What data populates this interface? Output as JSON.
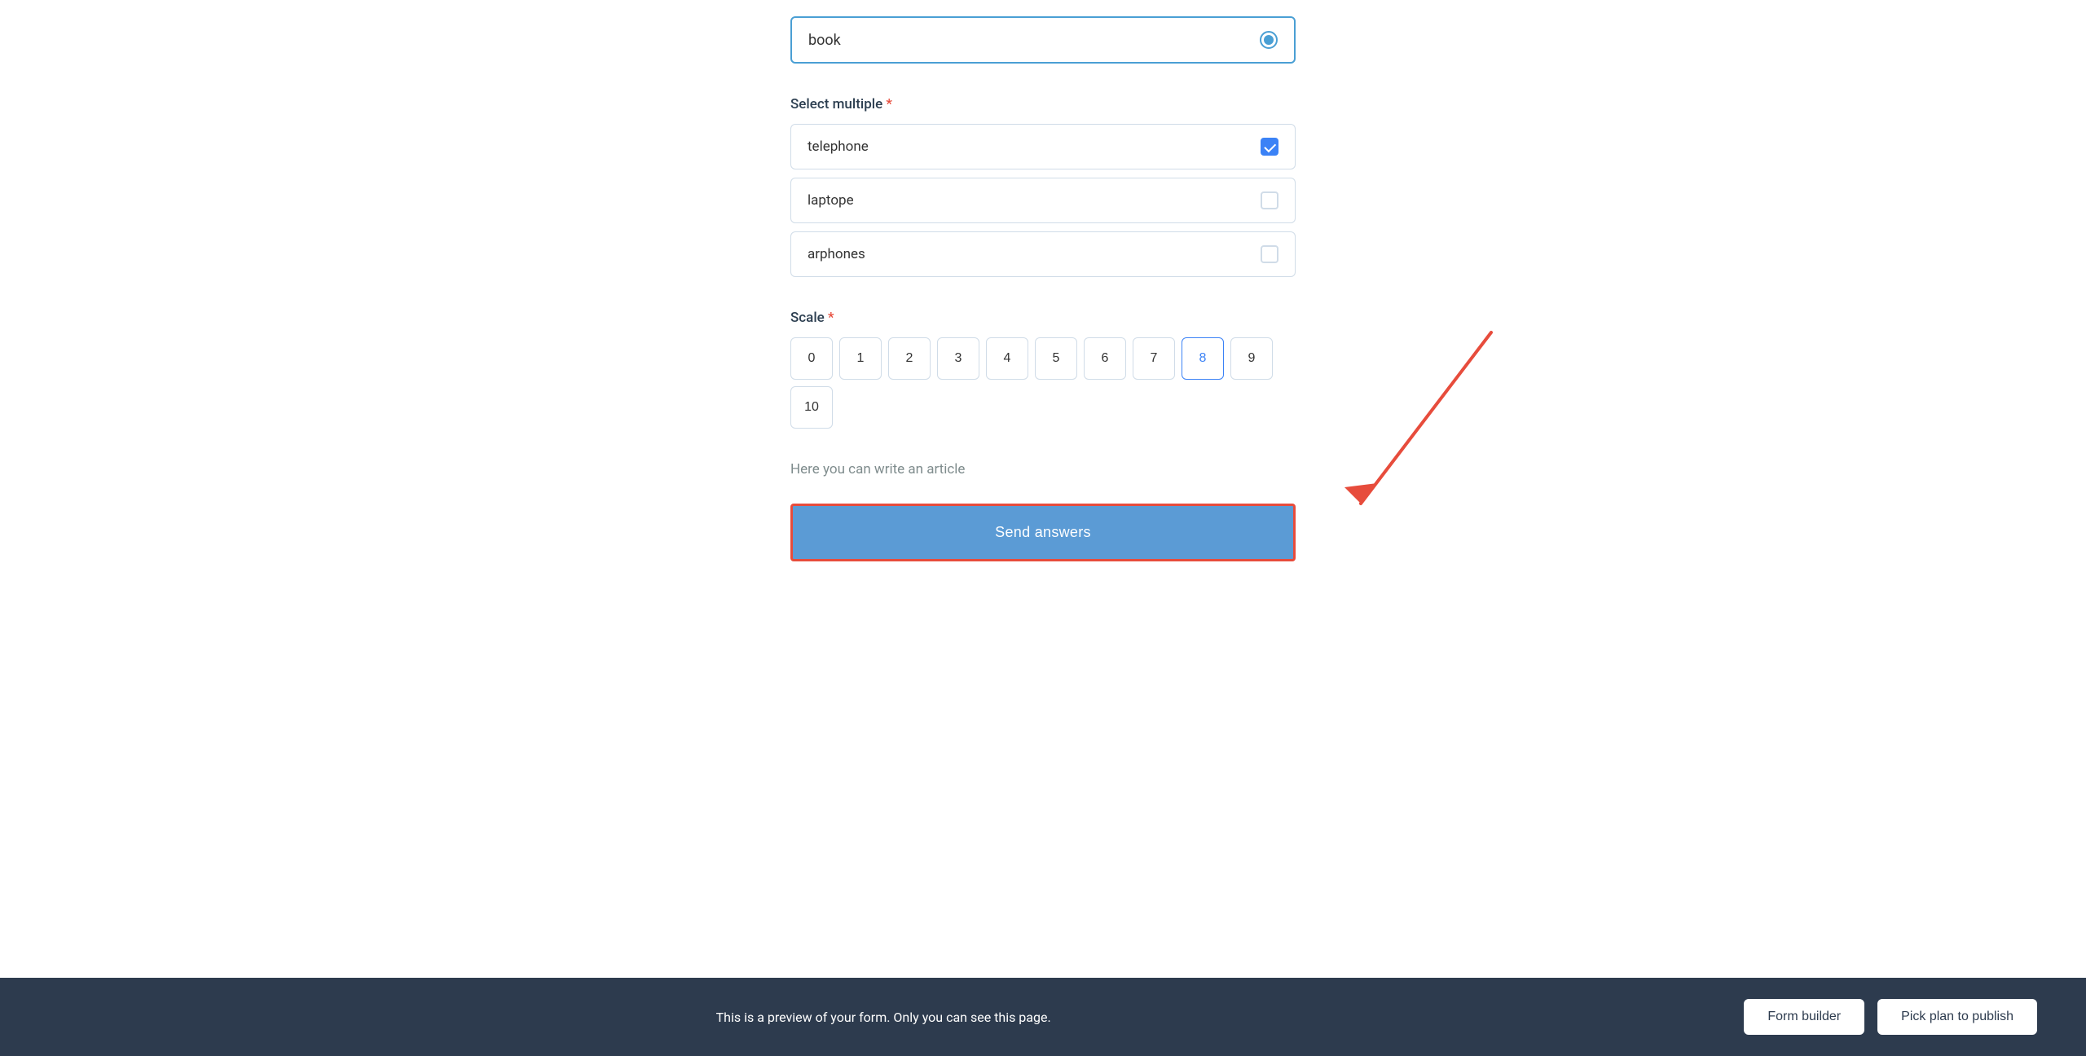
{
  "form": {
    "book_value": "book",
    "select_multiple_label": "Select multiple",
    "required_marker": "*",
    "options": [
      {
        "label": "telephone",
        "checked": true
      },
      {
        "label": "laptope",
        "checked": false
      },
      {
        "label": "arphones",
        "checked": false
      }
    ],
    "scale_label": "Scale",
    "scale_values": [
      "0",
      "1",
      "2",
      "3",
      "4",
      "5",
      "6",
      "7",
      "8",
      "9",
      "10"
    ],
    "scale_selected": "8",
    "article_placeholder": "Here you can write an article",
    "send_button_label": "Send answers"
  },
  "footer": {
    "preview_text": "This is a preview of your form. Only you can see this page.",
    "form_builder_label": "Form builder",
    "pick_plan_label": "Pick plan to publish"
  }
}
